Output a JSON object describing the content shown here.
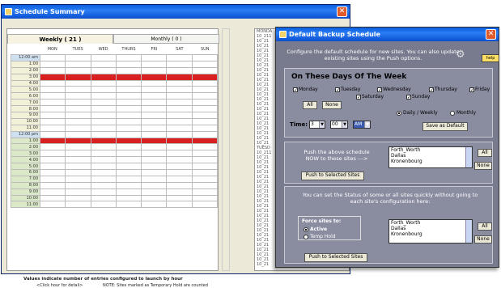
{
  "summary_window": {
    "title": "Schedule Summary",
    "tabs": [
      {
        "label": "Weekly  ( 21 )"
      },
      {
        "label": "Monthly  ( 0 )"
      }
    ],
    "days": [
      "MON",
      "TUES",
      "WED",
      "THURS",
      "FRI",
      "SAT",
      "SUN"
    ],
    "hours_am": [
      "12:00 am",
      "1:00",
      "2:00",
      "3:00",
      "4:00",
      "5:00",
      "6:00",
      "7:00",
      "8:00",
      "9:00",
      "10:00",
      "11:00"
    ],
    "hours_pm": [
      "12:00 pm",
      "1:00",
      "2:00",
      "3:00",
      "4:00",
      "5:00",
      "6:00",
      "7:00",
      "8:00",
      "9:00",
      "10:00",
      "11:00"
    ],
    "hot_rows": [
      "3:00 am",
      "1:00 pm"
    ],
    "footer_main": "Values indicate number of entries configured to launch by hour",
    "footer_hint": "<Click hour for detail>",
    "footer_note": "NOTE: Sites marked as Temporary Hold are counted",
    "log_lines": [
      "MONDA",
      "10_211",
      "10_21",
      "10_21",
      "10_21",
      "10_21",
      "10_21",
      "10_21",
      "10_21",
      "10_21",
      "10_21",
      "10_21",
      "10_21",
      "10_21",
      "10_21",
      "10_21",
      "10_21",
      "10_21",
      "10_21",
      "10_21",
      "10_21",
      "10_21",
      "10_21",
      "10_21",
      "TUESD",
      "10_211",
      "10_21",
      "10_21",
      "10_21",
      "10_21",
      "10_21",
      "10_21",
      "10_21",
      "10_21",
      "10_21",
      "10_21",
      "10_21",
      "10_21",
      "10_21",
      "10_21",
      "10_21",
      "10_21",
      "10_21",
      "10_21",
      "10_21",
      "10_21",
      "10_21",
      "10_21",
      "10_21"
    ]
  },
  "backup_window": {
    "title": "Default Backup Schedule",
    "intro": "Configure the default schedule for new sites. You can also update existing sites using the Push options.",
    "help_label": "help",
    "days_heading": "On These Days Of The Week",
    "days": {
      "mon": "Monday",
      "tue": "Tuesday",
      "wed": "Wednesday",
      "thu": "Thursday",
      "fri": "Friday",
      "sat": "Saturday",
      "sun": "Sunday"
    },
    "check": "✓",
    "all_label": "All",
    "none_label": "None",
    "freq_daily": "Daily / Weekly",
    "freq_monthly": "Monthly",
    "time_label": "Time:",
    "time_hour": "3",
    "time_min": "00",
    "time_ampm": "AM",
    "save_default": "Save as Default",
    "push_text_1": "Push the above schedule",
    "push_text_2": "NOW to these sites --->",
    "push_btn": "Push to Selected Sites",
    "sites": [
      "Forth_Worth",
      "Dallas",
      "Kronenbourg"
    ],
    "status_text": "You can set the Status of some or all sites quickly without going to each site's configuration here:",
    "force_title": "Force sites to:",
    "active": "Active",
    "temp_hold": "Temp Hold"
  },
  "colors": {
    "hot": "#d82020",
    "title": "#0a5ddc",
    "panel": "#8a8ca0"
  }
}
